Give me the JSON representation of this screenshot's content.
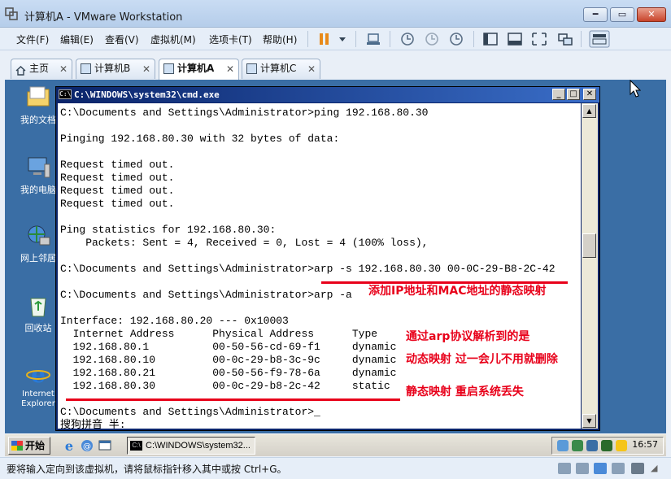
{
  "window": {
    "title": "计算机A - VMware Workstation"
  },
  "menu": [
    {
      "label": "文件(F)",
      "key": "file"
    },
    {
      "label": "编辑(E)",
      "key": "edit"
    },
    {
      "label": "查看(V)",
      "key": "view"
    },
    {
      "label": "虚拟机(M)",
      "key": "vm"
    },
    {
      "label": "选项卡(T)",
      "key": "tabs"
    },
    {
      "label": "帮助(H)",
      "key": "help"
    }
  ],
  "tabs": [
    {
      "label": "主页",
      "active": false
    },
    {
      "label": "计算机B",
      "active": false
    },
    {
      "label": "计算机A",
      "active": true
    },
    {
      "label": "计算机C",
      "active": false
    }
  ],
  "desktop_icons": [
    {
      "label": "我的文档",
      "icon": "folder-icon"
    },
    {
      "label": "我的电脑",
      "icon": "computer-icon"
    },
    {
      "label": "网上邻居",
      "icon": "network-icon"
    },
    {
      "label": "回收站",
      "icon": "recycle-bin-icon"
    },
    {
      "label": "Internet Explorer",
      "icon": "ie-icon"
    }
  ],
  "cmd": {
    "title": "C:\\WINDOWS\\system32\\cmd.exe",
    "lines": [
      "C:\\Documents and Settings\\Administrator>ping 192.168.80.30",
      "",
      "Pinging 192.168.80.30 with 32 bytes of data:",
      "",
      "Request timed out.",
      "Request timed out.",
      "Request timed out.",
      "Request timed out.",
      "",
      "Ping statistics for 192.168.80.30:",
      "    Packets: Sent = 4, Received = 0, Lost = 4 (100% loss),",
      "",
      "C:\\Documents and Settings\\Administrator>arp -s 192.168.80.30 00-0C-29-B8-2C-42",
      "",
      "C:\\Documents and Settings\\Administrator>arp -a",
      "",
      "Interface: 192.168.80.20 --- 0x10003",
      "  Internet Address      Physical Address      Type",
      "  192.168.80.1          00-50-56-cd-69-f1     dynamic",
      "  192.168.80.10         00-0c-29-b8-3c-9c     dynamic",
      "  192.168.80.21         00-50-56-f9-78-6a     dynamic",
      "  192.168.80.30         00-0c-29-b8-2c-42     static",
      "",
      "C:\\Documents and Settings\\Administrator>_",
      "搜狗拼音 半:"
    ]
  },
  "annotations": {
    "static_mapping": "添加IP地址和MAC地址的静态映射",
    "arp_dynamic_1": "通过arp协议解析到的是",
    "arp_dynamic_2": "动态映射 过一会儿不用就删除",
    "static_lost": "静态映射 重启系统丢失"
  },
  "guest_taskbar": {
    "start": "开始",
    "task_cmd": "C:\\WINDOWS\\system32...",
    "clock": "16:57"
  },
  "statusbar": {
    "text": "要将输入定向到该虚拟机，请将鼠标指针移入其中或按 Ctrl+G。"
  },
  "colors": {
    "annotation": "#e8001a",
    "desktop": "#3a6ea5",
    "cmd_title": "#0a246a"
  }
}
